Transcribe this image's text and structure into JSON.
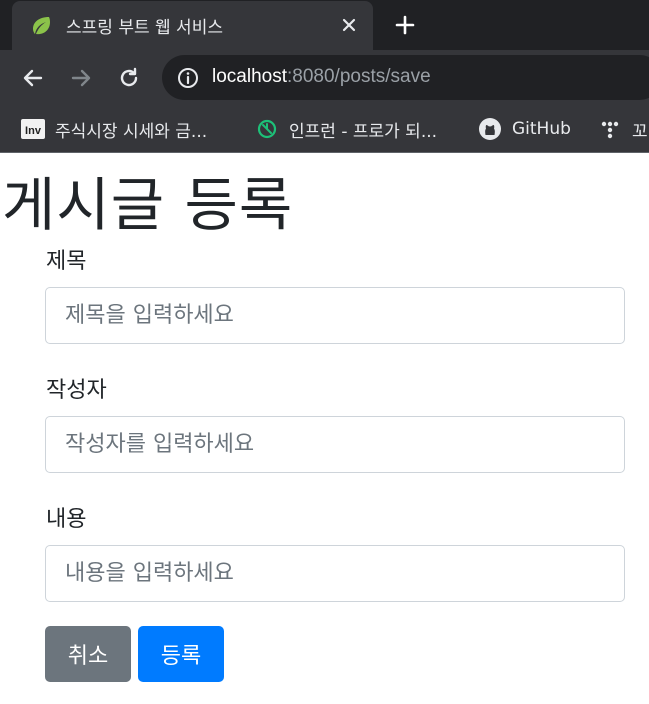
{
  "browser": {
    "tab": {
      "title": "스프링 부트 웹 서비스",
      "favicon": "spring-leaf-icon"
    },
    "url": {
      "host": "localhost",
      "path": ":8080/posts/save"
    },
    "bookmarks": [
      {
        "label": "주식시장 시세와 금...",
        "icon": "investing-icon"
      },
      {
        "label": "인프런 - 프로가 되...",
        "icon": "inflearn-icon"
      },
      {
        "label": "GitHub",
        "icon": "github-icon"
      },
      {
        "label": "꼬",
        "icon": "dots-app-icon"
      }
    ]
  },
  "page": {
    "title": "게시글 등록",
    "form": {
      "title_label": "제목",
      "title_placeholder": "제목을 입력하세요",
      "author_label": "작성자",
      "author_placeholder": "작성자를 입력하세요",
      "content_label": "내용",
      "content_placeholder": "내용을 입력하세요"
    },
    "buttons": {
      "cancel": "취소",
      "submit": "등록"
    }
  },
  "colors": {
    "primary": "#007bff",
    "secondary": "#6c757d",
    "chrome_dark": "#202124",
    "chrome_tab": "#35363a"
  }
}
